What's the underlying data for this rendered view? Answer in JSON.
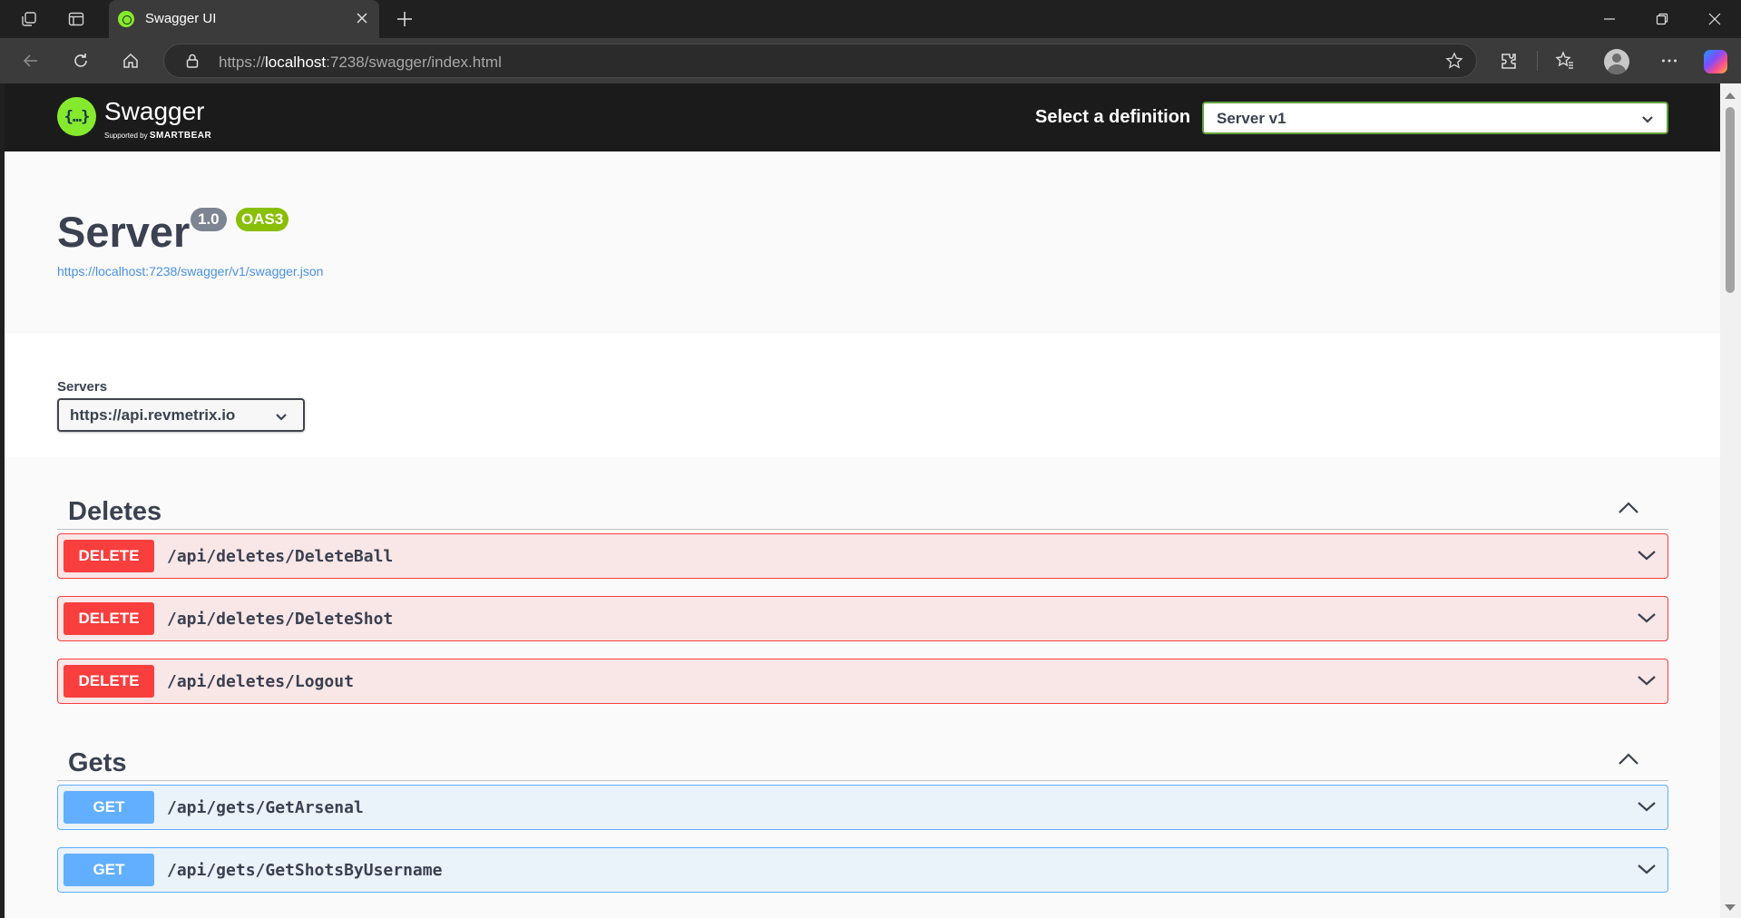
{
  "browser": {
    "tab": {
      "title": "Swagger UI"
    },
    "address": {
      "prefix": "https://",
      "host": "localhost",
      "path": ":7238/swagger/index.html"
    }
  },
  "swagger": {
    "topbar": {
      "logo_text": "Swagger",
      "logo_sub_prefix": "Supported by",
      "logo_sub_brand": "SMARTBEAR",
      "definition_label": "Select a definition",
      "definition_value": "Server v1"
    },
    "info": {
      "title": "Server",
      "version": "1.0",
      "oas": "OAS3",
      "json_url": "https://localhost:7238/swagger/v1/swagger.json"
    },
    "servers": {
      "label": "Servers",
      "selected": "https://api.revmetrix.io"
    },
    "groups": [
      {
        "name": "Deletes",
        "operations": [
          {
            "method": "DELETE",
            "path": "/api/deletes/DeleteBall"
          },
          {
            "method": "DELETE",
            "path": "/api/deletes/DeleteShot"
          },
          {
            "method": "DELETE",
            "path": "/api/deletes/Logout"
          }
        ]
      },
      {
        "name": "Gets",
        "operations": [
          {
            "method": "GET",
            "path": "/api/gets/GetArsenal"
          },
          {
            "method": "GET",
            "path": "/api/gets/GetShotsByUsername"
          }
        ]
      }
    ]
  },
  "colors": {
    "delete": "#f93e3e",
    "get": "#61affe",
    "oas_badge": "#89bf04",
    "swagger_green": "#85ea2d"
  }
}
